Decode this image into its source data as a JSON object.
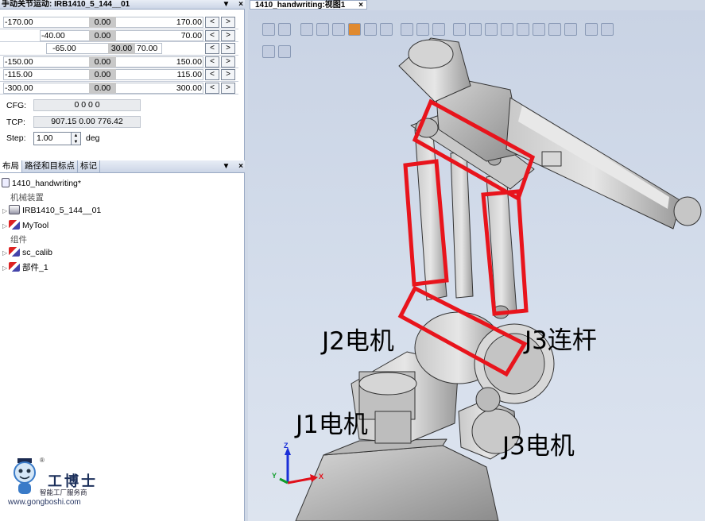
{
  "jog_panel": {
    "title": "手动关节运动: IRB1410_5_144__01",
    "controls": [
      "▼",
      "×"
    ],
    "joints": [
      {
        "min": "-170.00",
        "value": "0.00",
        "max": "170.00"
      },
      {
        "min": "-40.00",
        "value": "0.00",
        "max": "70.00"
      },
      {
        "min": "-65.00",
        "value": "30.00",
        "max": "70.00"
      },
      {
        "min": "-150.00",
        "value": "0.00",
        "max": "150.00"
      },
      {
        "min": "-115.00",
        "value": "0.00",
        "max": "115.00"
      },
      {
        "min": "-300.00",
        "value": "0.00",
        "max": "300.00"
      }
    ],
    "dec_label": "<",
    "inc_label": ">",
    "cfg_label": "CFG:",
    "cfg_value": "0 0 0 0",
    "tcp_label": "TCP:",
    "tcp_value": "907.15 0.00 776.42",
    "step_label": "Step:",
    "step_value": "1.00",
    "step_unit": "deg"
  },
  "layout_panel": {
    "tabs": [
      "布局",
      "路径和目标点",
      "标记"
    ],
    "controls": [
      "▼",
      "×"
    ],
    "root": "1410_handwriting*",
    "group_mechanisms": "机械装置",
    "robot": "IRB1410_5_144__01",
    "tool": "MyTool",
    "group_components": "组件",
    "component_1": "sc_calib",
    "component_2": "部件_1"
  },
  "view": {
    "tab_title": "1410_handwriting:视图1",
    "tab_close": "×",
    "annotations": {
      "j2_motor": "J2电机",
      "j3_link": "J3连杆",
      "j1_motor": "J1电机",
      "j3_motor": "J3电机"
    },
    "axis_labels": {
      "z": "Z",
      "y": "Y",
      "x": "X"
    }
  },
  "watermark": {
    "name": "工博士",
    "registered": "®",
    "subtitle": "智能工厂服务商",
    "url": "www.gongboshi.com"
  },
  "colors": {
    "highlight_box": "#e8141c",
    "panel_header": "#cbd5e6",
    "viewport_bg": "#cfd8e6",
    "axis_x": "#e0101a",
    "axis_y": "#0f9d2a",
    "axis_z": "#1a2fd8"
  }
}
